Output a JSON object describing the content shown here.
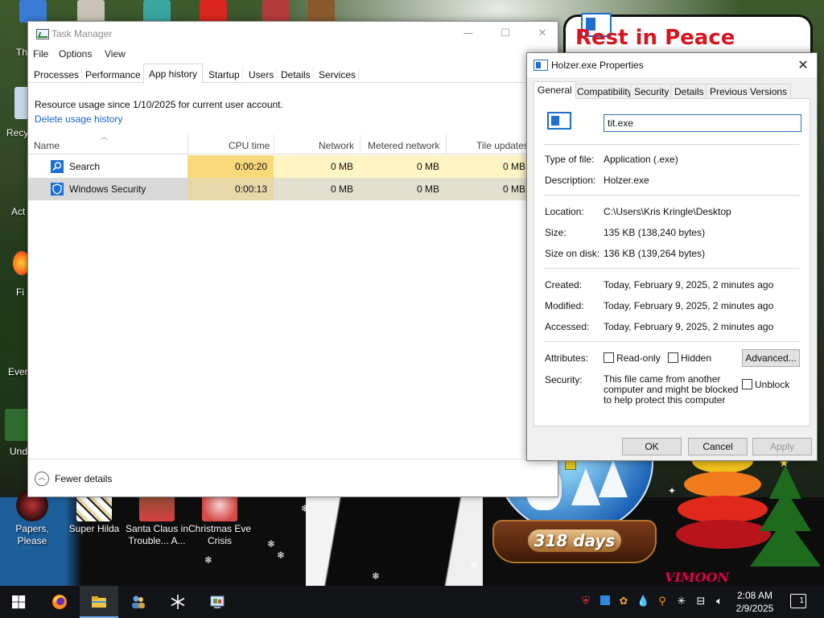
{
  "desktop": {
    "banner_text": "Rest in Peace",
    "icons": [
      {
        "label": "Papers, Please"
      },
      {
        "label": "Super Hilda"
      },
      {
        "label": "Santa Claus in Trouble... A..."
      },
      {
        "label": "Christmas Eve Crisis"
      }
    ],
    "left_labels": [
      "Th",
      "Recy",
      "Act",
      "Fi",
      "Ever",
      "Und"
    ],
    "globe_days": "318 days",
    "decoration_sign": "VIMOON"
  },
  "task_manager": {
    "title": "Task Manager",
    "menu": [
      "File",
      "Options",
      "View"
    ],
    "tabs": [
      "Processes",
      "Performance",
      "App history",
      "Startup",
      "Users",
      "Details",
      "Services"
    ],
    "active_tab": "App history",
    "info_text": "Resource usage since 1/10/2025 for current user account.",
    "delete_link": "Delete usage history",
    "columns": [
      "Name",
      "CPU time",
      "Network",
      "Metered network",
      "Tile updates"
    ],
    "rows": [
      {
        "name": "Search",
        "icon": "search-app-icon",
        "cpu": "0:00:20",
        "network": "0 MB",
        "metered": "0 MB",
        "tile": "0 MB"
      },
      {
        "name": "Windows Security",
        "icon": "windows-security-icon",
        "cpu": "0:00:13",
        "network": "0 MB",
        "metered": "0 MB",
        "tile": "0 MB"
      }
    ],
    "fewer_details": "Fewer details",
    "colors": {
      "heat_high": "#f9d97a",
      "heat_low": "#fff4c4",
      "row_selected": "#d9d9d9",
      "link": "#1a62c6"
    }
  },
  "properties": {
    "title": "Holzer.exe Properties",
    "tabs": [
      "General",
      "Compatibility",
      "Security",
      "Details",
      "Previous Versions"
    ],
    "active_tab": "General",
    "filename_value": "tit.exe",
    "fields": {
      "type_label": "Type of file:",
      "type_value": "Application (.exe)",
      "desc_label": "Description:",
      "desc_value": "Holzer.exe",
      "location_label": "Location:",
      "location_value": "C:\\Users\\Kris Kringle\\Desktop",
      "size_label": "Size:",
      "size_value": "135 KB (138,240 bytes)",
      "disk_label": "Size on disk:",
      "disk_value": "136 KB (139,264 bytes)",
      "created_label": "Created:",
      "created_value": "Today, February 9, 2025, 2 minutes ago",
      "modified_label": "Modified:",
      "modified_value": "Today, February 9, 2025, 2 minutes ago",
      "accessed_label": "Accessed:",
      "accessed_value": "Today, February 9, 2025, 2 minutes ago",
      "attributes_label": "Attributes:",
      "readonly_label": "Read-only",
      "hidden_label": "Hidden",
      "advanced_button": "Advanced...",
      "security_label": "Security:",
      "security_text": "This file came from another computer and might be blocked to help protect this computer",
      "unblock_label": "Unblock"
    },
    "buttons": {
      "ok": "OK",
      "cancel": "Cancel",
      "apply": "Apply"
    }
  },
  "taskbar": {
    "items": [
      "start-button",
      "firefox",
      "file-explorer",
      "people-app",
      "snowflake-app",
      "control-panel"
    ],
    "clock_time": "2:08 AM",
    "clock_date": "2/9/2025",
    "notification_count": "1"
  }
}
